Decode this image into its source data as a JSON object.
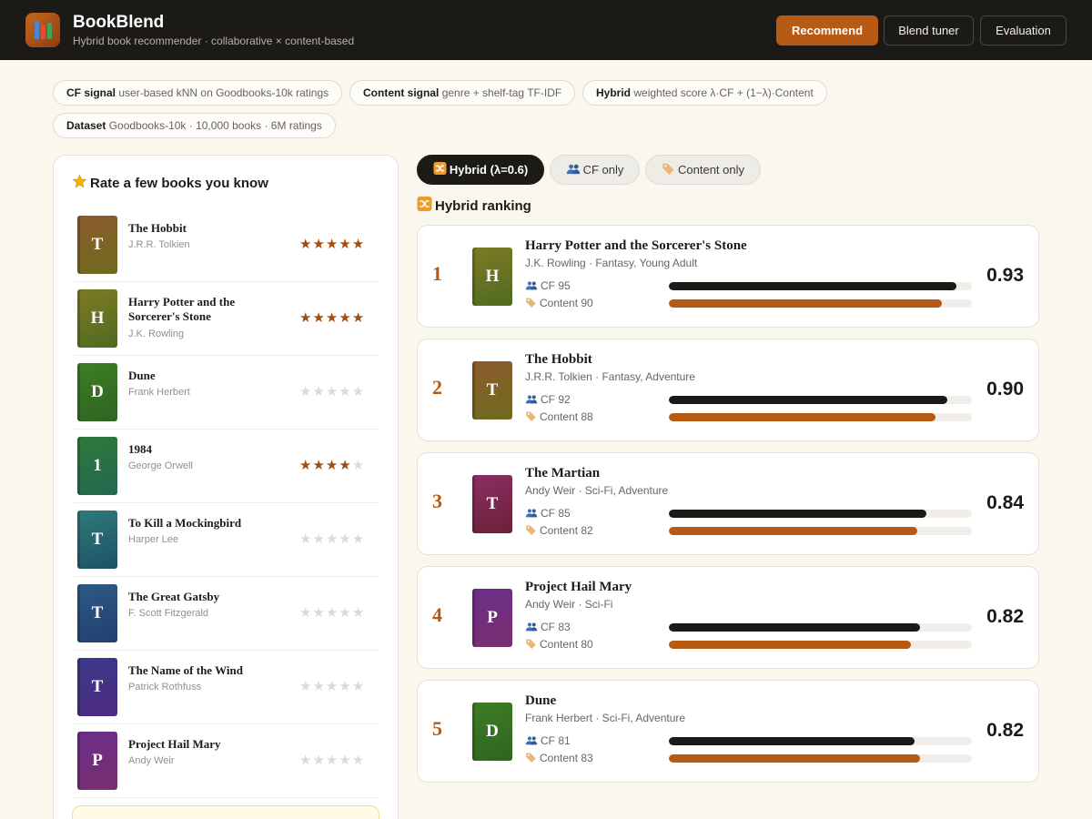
{
  "app": {
    "title": "BookBlend",
    "subtitle": "Hybrid book recommender · collaborative × content-based",
    "logo_icon": "books-icon"
  },
  "nav": {
    "recommend": "Recommend",
    "blend_tuner": "Blend tuner",
    "evaluation": "Evaluation",
    "active": "Recommend"
  },
  "chips": {
    "cf": {
      "label": "CF signal",
      "text": "user-based kNN on Goodbooks-10k ratings"
    },
    "content": {
      "label": "Content signal",
      "text": "genre + shelf-tag TF-IDF"
    },
    "hybrid": {
      "label": "Hybrid",
      "text": "weighted score λ·CF + (1−λ)·Content"
    },
    "dataset": {
      "label": "Dataset",
      "text": "Goodbooks-10k · 10,000 books · 6M ratings"
    }
  },
  "rate_panel": {
    "title": "Rate a few books you know",
    "title_icon": "star-icon",
    "books": [
      {
        "title": "The Hobbit",
        "author": "J.R.R. Tolkien",
        "initial": "T",
        "rating": 5,
        "cover": [
          "#8d5a2c",
          "#6e6a1e"
        ]
      },
      {
        "title": "Harry Potter and the Sorcerer's Stone",
        "author": "J.K. Rowling",
        "initial": "H",
        "rating": 5,
        "cover": [
          "#7e7a24",
          "#4f6b20"
        ]
      },
      {
        "title": "Dune",
        "author": "Frank Herbert",
        "initial": "D",
        "rating": 0,
        "cover": [
          "#3e7d24",
          "#2d6521"
        ]
      },
      {
        "title": "1984",
        "author": "George Orwell",
        "initial": "1",
        "rating": 4,
        "cover": [
          "#2e7a3c",
          "#22684e"
        ]
      },
      {
        "title": "To Kill a Mockingbird",
        "author": "Harper Lee",
        "initial": "T",
        "rating": 0,
        "cover": [
          "#2e7a78",
          "#1e5266"
        ]
      },
      {
        "title": "The Great Gatsby",
        "author": "F. Scott Fitzgerald",
        "initial": "T",
        "rating": 0,
        "cover": [
          "#2e5a86",
          "#223f70"
        ]
      },
      {
        "title": "The Name of the Wind",
        "author": "Patrick Rothfuss",
        "initial": "T",
        "rating": 0,
        "cover": [
          "#3a3a8a",
          "#4e2a80"
        ]
      },
      {
        "title": "Project Hail Mary",
        "author": "Andy Weir",
        "initial": "P",
        "rating": 0,
        "cover": [
          "#6a2e8a",
          "#7a2e6e"
        ]
      }
    ]
  },
  "tabs": [
    {
      "label": "Hybrid (λ=0.6)",
      "icon": "shuffle-icon",
      "active": true
    },
    {
      "label": "CF only",
      "icon": "users-icon",
      "active": false
    },
    {
      "label": "Content only",
      "icon": "tag-icon",
      "active": false
    }
  ],
  "ranking": {
    "title": "Hybrid ranking",
    "title_icon": "shuffle-icon",
    "cf_label": "CF",
    "content_label": "Content",
    "items": [
      {
        "rank": "1",
        "title": "Harry Potter and the Sorcerer's Stone",
        "meta": "J.K. Rowling · Fantasy, Young Adult",
        "initial": "H",
        "cf": 95,
        "content": 90,
        "score": "0.93",
        "cover": [
          "#7e7a24",
          "#4f6b20"
        ]
      },
      {
        "rank": "2",
        "title": "The Hobbit",
        "meta": "J.R.R. Tolkien · Fantasy, Adventure",
        "initial": "T",
        "cf": 92,
        "content": 88,
        "score": "0.90",
        "cover": [
          "#8d5a2c",
          "#6e6a1e"
        ]
      },
      {
        "rank": "3",
        "title": "The Martian",
        "meta": "Andy Weir · Sci-Fi, Adventure",
        "initial": "T",
        "cf": 85,
        "content": 82,
        "score": "0.84",
        "cover": [
          "#8a2e64",
          "#6a2236"
        ]
      },
      {
        "rank": "4",
        "title": "Project Hail Mary",
        "meta": "Andy Weir · Sci-Fi",
        "initial": "P",
        "cf": 83,
        "content": 80,
        "score": "0.82",
        "cover": [
          "#6a2e8a",
          "#7a2e6e"
        ]
      },
      {
        "rank": "5",
        "title": "Dune",
        "meta": "Frank Herbert · Sci-Fi, Adventure",
        "initial": "D",
        "cf": 81,
        "content": 83,
        "score": "0.82",
        "cover": [
          "#3e7d24",
          "#2d6521"
        ]
      }
    ]
  },
  "colors": {
    "accent": "#b65a14",
    "dark": "#1c1a17",
    "star_on": "#a34d0f",
    "background": "#faf7ef"
  }
}
